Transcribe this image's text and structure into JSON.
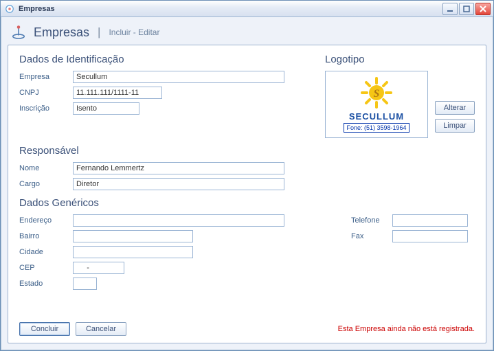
{
  "window": {
    "title": "Empresas"
  },
  "header": {
    "title": "Empresas",
    "subtitle": "Incluir - Editar"
  },
  "sections": {
    "ident_title": "Dados de Identificação",
    "logo_title": "Logotipo",
    "resp_title": "Responsável",
    "gen_title": "Dados Genéricos"
  },
  "labels": {
    "empresa": "Empresa",
    "cnpj": "CNPJ",
    "inscricao": "Inscrição",
    "nome": "Nome",
    "cargo": "Cargo",
    "endereco": "Endereço",
    "bairro": "Bairro",
    "cidade": "Cidade",
    "cep": "CEP",
    "estado": "Estado",
    "telefone": "Telefone",
    "fax": "Fax"
  },
  "values": {
    "empresa": "Secullum",
    "cnpj": "11.111.111/1111-11",
    "inscricao": "Isento",
    "nome": "Fernando Lemmertz",
    "cargo": "Diretor",
    "endereco": "",
    "bairro": "",
    "cidade": "",
    "cep": "     -",
    "estado": "",
    "telefone": "",
    "fax": ""
  },
  "logo": {
    "brand": "SECULLUM",
    "phone": "Fone: (51) 3598-1964"
  },
  "buttons": {
    "alterar": "Alterar",
    "limpar": "Limpar",
    "concluir": "Concluir",
    "cancelar": "Cancelar"
  },
  "footer_msg": "Esta Empresa ainda não está registrada."
}
